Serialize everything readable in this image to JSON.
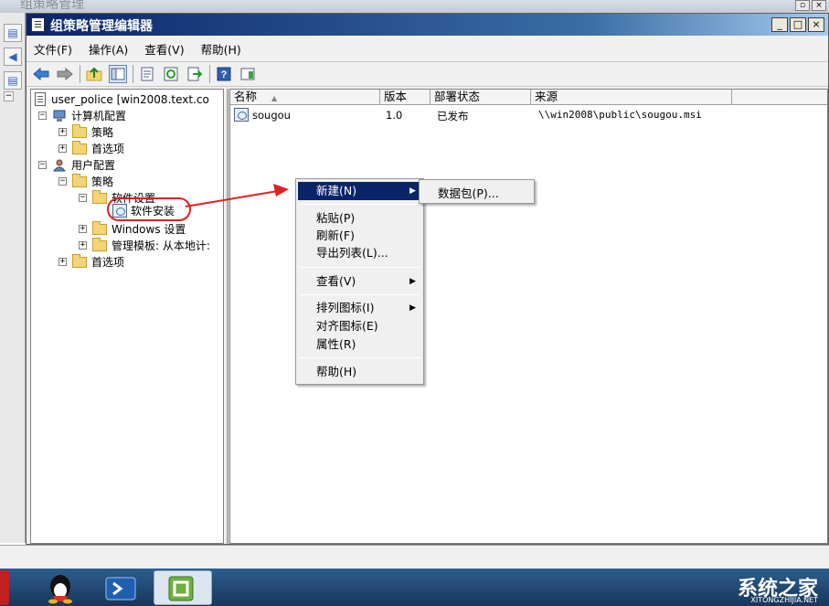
{
  "outer_window": {
    "title": "组策略管理"
  },
  "window": {
    "title": "组策略管理编辑器",
    "controls": {
      "minimize": "_",
      "maximize": "□",
      "close": "×"
    }
  },
  "menubar": {
    "items": [
      {
        "label": "文件(F)"
      },
      {
        "label": "操作(A)"
      },
      {
        "label": "查看(V)"
      },
      {
        "label": "帮助(H)"
      }
    ]
  },
  "toolbar": {
    "icons": [
      "back-arrow-icon",
      "forward-arrow-icon",
      "up-folder-icon",
      "show-hide-tree-icon",
      "properties-icon",
      "refresh-icon",
      "export-list-icon",
      "help-icon",
      "show-action-pane-icon"
    ]
  },
  "tree": {
    "root": "user_police [win2008.text.co",
    "items": [
      {
        "label": "计算机配置",
        "expander": "−"
      },
      {
        "label": "策略",
        "expander": "+"
      },
      {
        "label": "首选项",
        "expander": "+"
      },
      {
        "label": "用户配置",
        "expander": "−"
      },
      {
        "label": "策略",
        "expander": "−"
      },
      {
        "label": "软件设置",
        "expander": "−"
      },
      {
        "label": "软件安装",
        "expander": ""
      },
      {
        "label": "Windows 设置",
        "expander": "+"
      },
      {
        "label": "管理模板: 从本地计:",
        "expander": "+"
      },
      {
        "label": "首选项",
        "expander": "+"
      }
    ]
  },
  "list": {
    "columns": [
      {
        "label": "名称"
      },
      {
        "label": "版本"
      },
      {
        "label": "部署状态"
      },
      {
        "label": "来源"
      }
    ],
    "rows": [
      {
        "name": "sougou",
        "version": "1.0",
        "status": "已发布",
        "source": "\\\\win2008\\public\\sougou.msi"
      }
    ]
  },
  "context_menu": {
    "items": [
      {
        "label": "新建(N)",
        "has_submenu": true,
        "highlighted": true
      },
      {
        "label": "粘贴(P)"
      },
      {
        "label": "刷新(F)"
      },
      {
        "label": "导出列表(L)..."
      },
      {
        "label": "查看(V)",
        "has_submenu": true
      },
      {
        "label": "排列图标(I)",
        "has_submenu": true
      },
      {
        "label": "对齐图标(E)"
      },
      {
        "label": "属性(R)"
      },
      {
        "label": "帮助(H)"
      }
    ],
    "submenu": {
      "label": "数据包(P)..."
    },
    "submenu_arrow": "▶"
  },
  "watermark": {
    "brand": "系统之家",
    "url": "XITONGZHIJIA.NET"
  },
  "colors": {
    "highlight": "#0a246a",
    "annotation_red": "#e02020"
  }
}
